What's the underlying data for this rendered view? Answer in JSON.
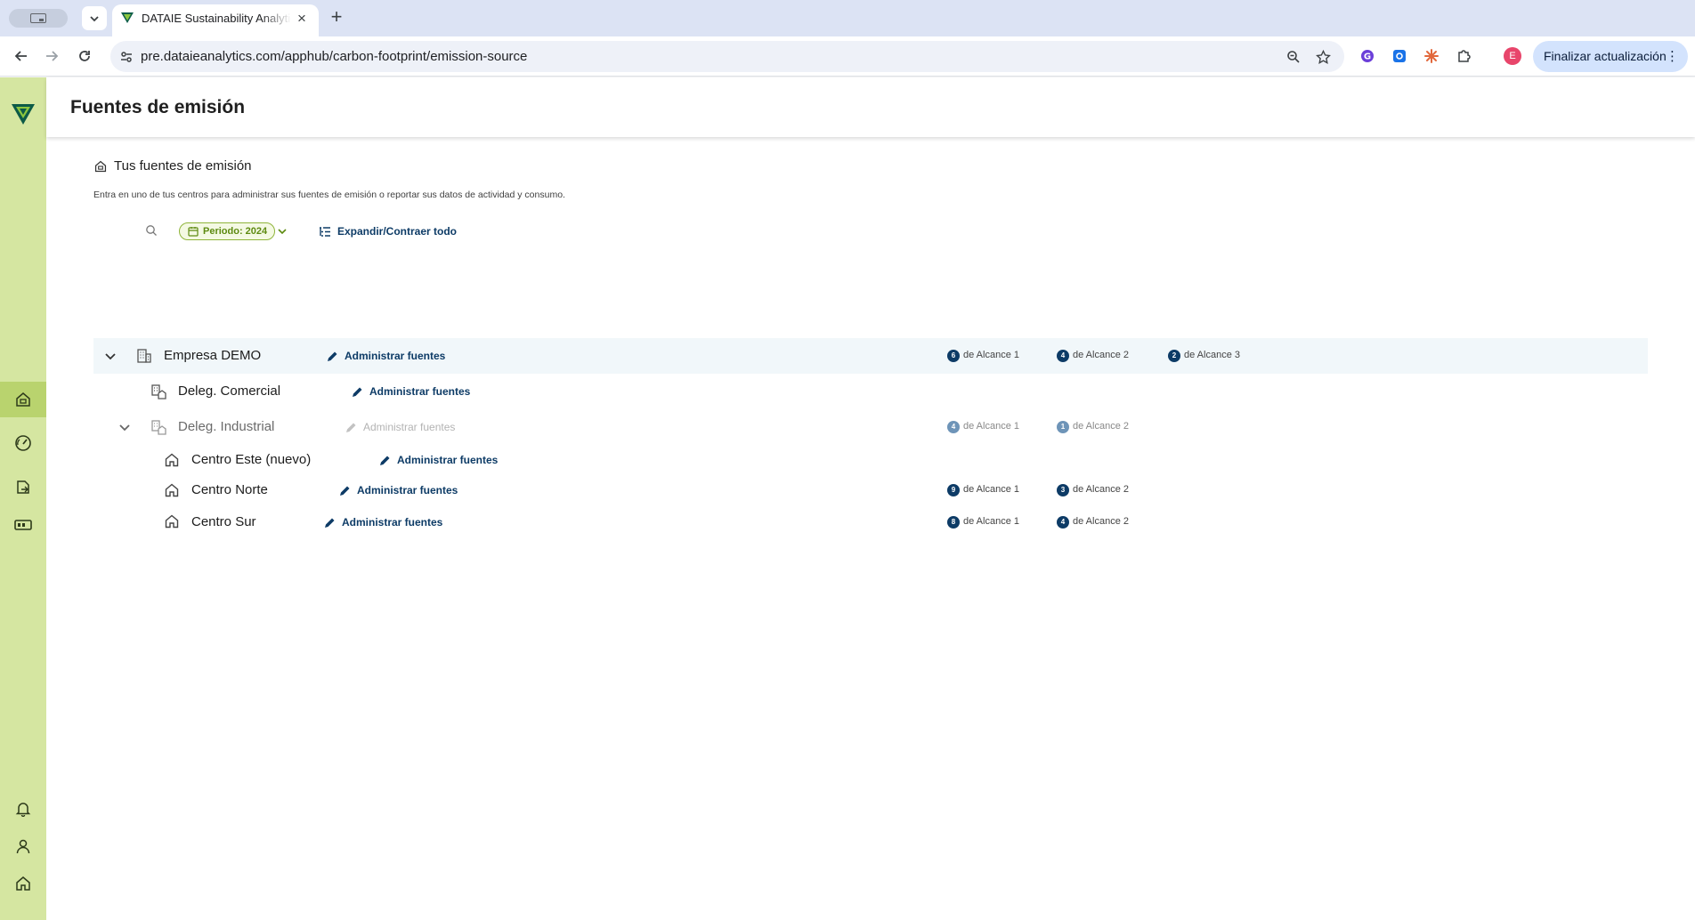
{
  "browser": {
    "tab_title": "DATAIE Sustainability Analytics",
    "url": "pre.dataieanalytics.com/apphub/carbon-footprint/emission-source",
    "profile_initial": "E",
    "update_label": "Finalizar actualización"
  },
  "page": {
    "title": "Fuentes de emisión",
    "section_title": "Tus fuentes de emisión",
    "description": "Entra en uno de tus centros para administrar sus fuentes de emisión o reportar sus datos de actividad y consumo.",
    "period_label": "Periodo: 2024",
    "expand_label": "Expandir/Contraer todo"
  },
  "tree": {
    "manage_label": "Administrar fuentes",
    "empresa": {
      "label": "Empresa DEMO",
      "scopes": [
        {
          "count": "6",
          "label": "de Alcance 1"
        },
        {
          "count": "4",
          "label": "de Alcance 2"
        },
        {
          "count": "2",
          "label": "de Alcance 3"
        }
      ]
    },
    "comercial": {
      "label": "Deleg. Comercial"
    },
    "industrial": {
      "label": "Deleg. Industrial",
      "scopes": [
        {
          "count": "4",
          "label": "de Alcance 1"
        },
        {
          "count": "1",
          "label": "de Alcance 2"
        }
      ]
    },
    "este": {
      "label": "Centro Este (nuevo)"
    },
    "norte": {
      "label": "Centro Norte",
      "scopes": [
        {
          "count": "9",
          "label": "de Alcance 1"
        },
        {
          "count": "3",
          "label": "de Alcance 2"
        }
      ]
    },
    "sur": {
      "label": "Centro Sur",
      "scopes": [
        {
          "count": "8",
          "label": "de Alcance 1"
        },
        {
          "count": "4",
          "label": "de Alcance 2"
        }
      ]
    }
  },
  "colors": {
    "accent": "#0d3b66",
    "sidebar": "#d5e6a1",
    "sidebar_active": "#b9d36e",
    "period_chip": "#5d8a10"
  }
}
